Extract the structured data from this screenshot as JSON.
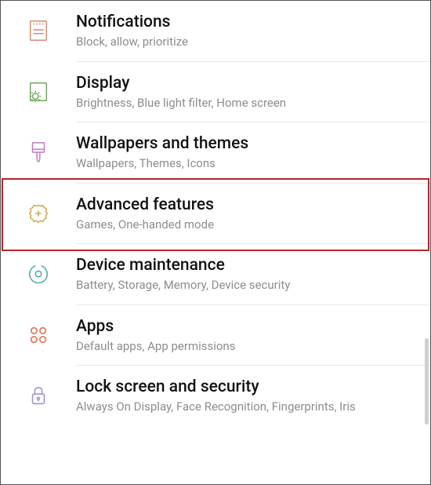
{
  "settings": {
    "items": [
      {
        "key": "notifications",
        "icon": "notifications-icon",
        "color": "#d98a74",
        "title": "Notifications",
        "subtitle": "Block, allow, prioritize"
      },
      {
        "key": "display",
        "icon": "display-icon",
        "color": "#6fa861",
        "title": "Display",
        "subtitle": "Brightness, Blue light filter, Home screen"
      },
      {
        "key": "wallpapers",
        "icon": "paintbrush-icon",
        "color": "#c17bc4",
        "title": "Wallpapers and themes",
        "subtitle": "Wallpapers, Themes, Icons"
      },
      {
        "key": "advanced",
        "icon": "gear-plus-icon",
        "color": "#d0a74b",
        "title": "Advanced features",
        "subtitle": "Games, One-handed mode"
      },
      {
        "key": "maintenance",
        "icon": "power-circle-icon",
        "color": "#4aa89e",
        "title": "Device maintenance",
        "subtitle": "Battery, Storage, Memory, Device security"
      },
      {
        "key": "apps",
        "icon": "apps-grid-icon",
        "color": "#e07a5a",
        "title": "Apps",
        "subtitle": "Default apps, App permissions"
      },
      {
        "key": "lock",
        "icon": "lock-icon",
        "color": "#9a8fc9",
        "title": "Lock screen and security",
        "subtitle": "Always On Display, Face Recognition, Fingerprints, Iris"
      }
    ],
    "highlighted_key": "advanced",
    "highlight_color": "#b3242b"
  }
}
